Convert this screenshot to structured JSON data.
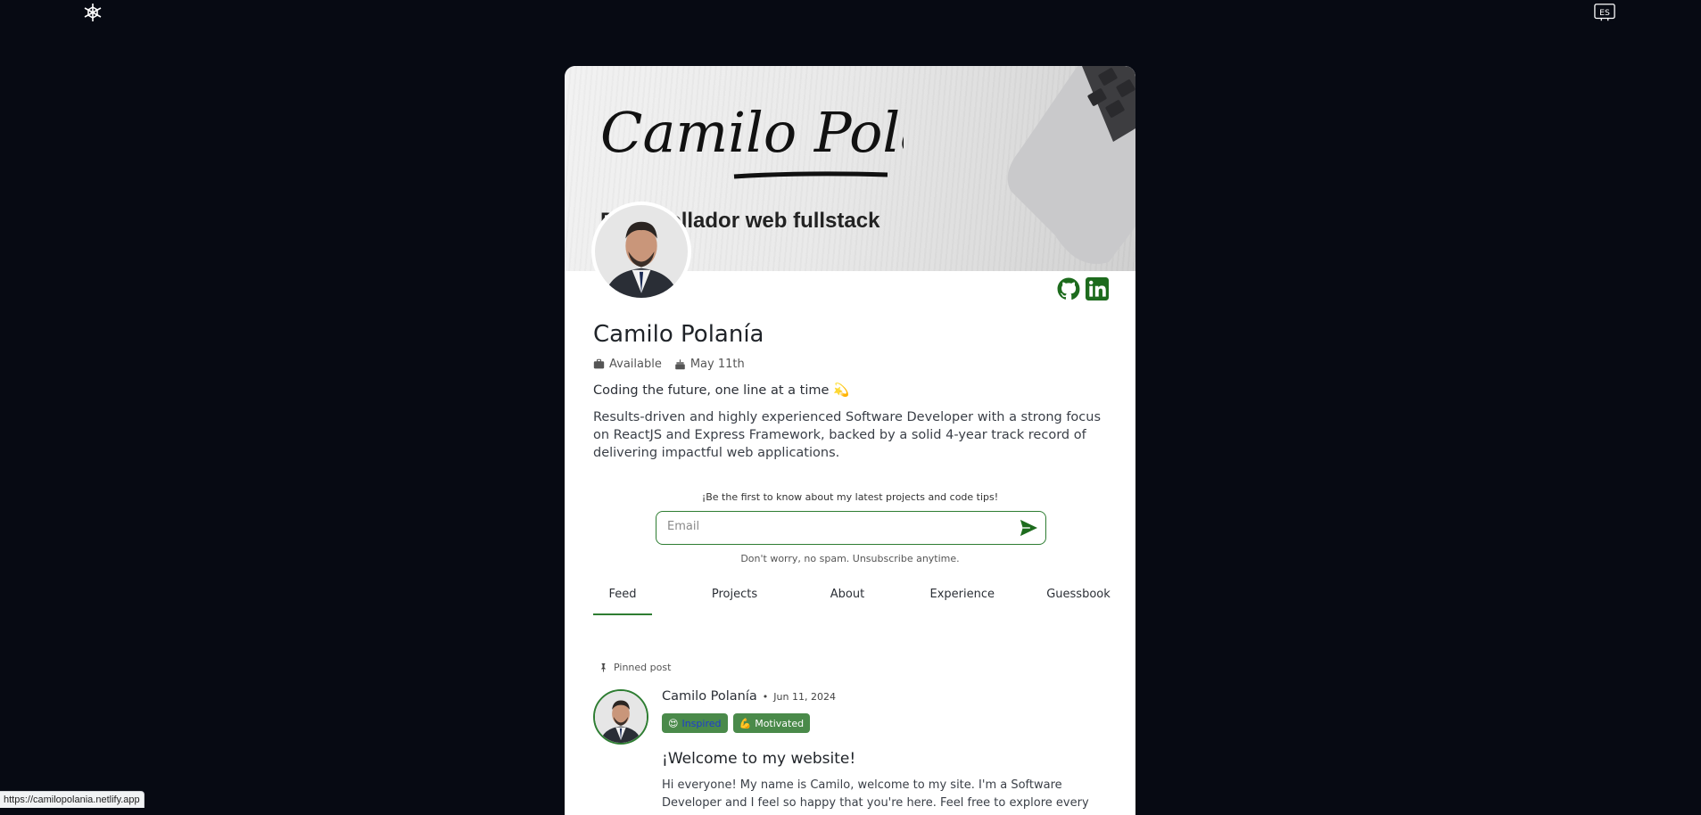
{
  "header": {
    "logo_icon": "snowflake-gear-logo-icon",
    "language_icon": "language-toggle-icon",
    "language_label": "ES"
  },
  "profile": {
    "name": "Camilo Polanía",
    "status": "Available",
    "birthday": "May 11th",
    "tagline": "Coding the future, one line at a time",
    "tagline_emoji": "💫",
    "bio": "Results-driven and highly experienced Software Developer with a strong focus on ReactJS and Express Framework, backed by a solid 4-year track record of delivering impactful web applications."
  },
  "banner": {
    "signature": "Camilo Polanía",
    "role": "Desarrollador web fullstack"
  },
  "socials": [
    {
      "name": "github",
      "icon": "github-icon"
    },
    {
      "name": "linkedin",
      "icon": "linkedin-icon"
    }
  ],
  "subscribe": {
    "title": "¡Be the first to know about my latest projects and code tips!",
    "placeholder": "Email",
    "note": "Don't worry, no spam. Unsubscribe anytime."
  },
  "tabs": [
    {
      "label": "Feed",
      "active": true
    },
    {
      "label": "Projects",
      "active": false
    },
    {
      "label": "About",
      "active": false
    },
    {
      "label": "Experience",
      "active": false
    },
    {
      "label": "Guessbook",
      "active": false
    }
  ],
  "post": {
    "pinned_label": "Pinned post",
    "author": "Camilo Polanía",
    "separator": "•",
    "date": "Jun 11, 2024",
    "badges": [
      {
        "emoji": "😍",
        "label": "Inspired"
      },
      {
        "emoji": "💪",
        "label": "Motivated"
      }
    ],
    "title": "¡Welcome to my website!",
    "body": "Hi everyone! My name is Camilo, welcome to my site. I'm a Software Developer and I feel so happy that you're here. Feel free to explore every corner of this webpage and"
  },
  "status_bar": {
    "url": "https://camilopolania.netlify.app"
  },
  "colors": {
    "background": "#070a13",
    "accent_green": "#2e7d32",
    "badge_green": "#4a8a4a"
  }
}
